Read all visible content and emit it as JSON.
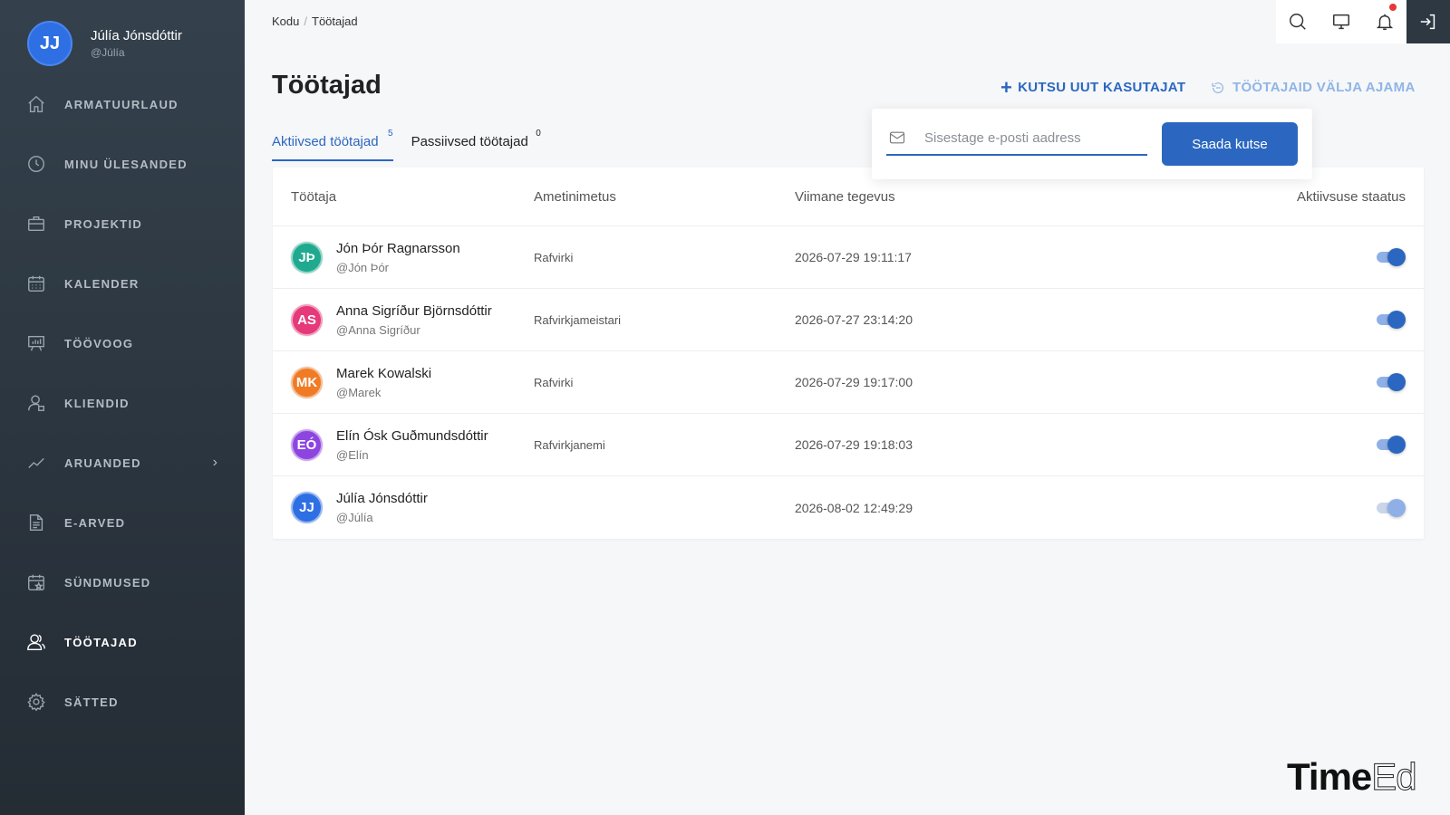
{
  "user": {
    "initials": "JJ",
    "name": "Júlía Jónsdóttir",
    "handle": "@Júlía",
    "avatar_color": "#2f6fe4"
  },
  "sidebar": {
    "items": [
      {
        "label": "ARMATUURLAUD",
        "icon": "home-icon"
      },
      {
        "label": "MINU ÜLESANDED",
        "icon": "clock-icon"
      },
      {
        "label": "PROJEKTID",
        "icon": "briefcase-icon"
      },
      {
        "label": "KALENDER",
        "icon": "calendar-icon"
      },
      {
        "label": "TÖÖVOOG",
        "icon": "presentation-board-icon"
      },
      {
        "label": "KLIENDID",
        "icon": "user-icon"
      },
      {
        "label": "ARUANDED",
        "icon": "trend-line-icon"
      },
      {
        "label": "E-ARVED",
        "icon": "document-icon"
      },
      {
        "label": "SÜNDMUSED",
        "icon": "calendar-star-icon"
      },
      {
        "label": "TÖÖTAJAD",
        "icon": "users-icon"
      },
      {
        "label": "SÄTTED",
        "icon": "gear-icon"
      }
    ]
  },
  "breadcrumb": {
    "home": "Kodu",
    "current": "Töötajad"
  },
  "header": {
    "title": "Töötajad",
    "invite_label": "KUTSU UUT KASUTAJAT",
    "logout_all_label": "TÖÖTAJAID VÄLJA AJAMA"
  },
  "tabs": [
    {
      "label": "Aktiivsed töötajad",
      "count": "5"
    },
    {
      "label": "Passiivsed töötajad",
      "count": "0"
    }
  ],
  "invite": {
    "placeholder": "Sisestage e-posti aadress",
    "button": "Saada kutse"
  },
  "table": {
    "columns": [
      "Töötaja",
      "Ametinimetus",
      "Viimane tegevus",
      "Aktiivsuse staatus"
    ],
    "rows": [
      {
        "initials": "JÞ",
        "name": "Jón Þór Ragnarsson",
        "handle": "@Jón Þór",
        "title": "Rafvirki",
        "last": "2026-07-29 19:11:17",
        "color": "#1faa8f",
        "active": true
      },
      {
        "initials": "AS",
        "name": "Anna Sigríður Björnsdóttir",
        "handle": "@Anna Sigríður",
        "title": "Rafvirkjameistari",
        "last": "2026-07-27 23:14:20",
        "color": "#e6397a",
        "active": true
      },
      {
        "initials": "MK",
        "name": "Marek Kowalski",
        "handle": "@Marek",
        "title": "Rafvirki",
        "last": "2026-07-29 19:17:00",
        "color": "#f07b25",
        "active": true
      },
      {
        "initials": "EÓ",
        "name": "Elín Ósk Guðmundsdóttir",
        "handle": "@Elín",
        "title": "Rafvirkjanemi",
        "last": "2026-07-29 19:18:03",
        "color": "#8e45e0",
        "active": true
      },
      {
        "initials": "JJ",
        "name": "Júlía Jónsdóttir",
        "handle": "@Júlía",
        "title": "",
        "last": "2026-08-02 12:49:29",
        "color": "#2f6fe4",
        "active": false
      }
    ]
  },
  "brand": {
    "part1": "Time",
    "part2": "Ed"
  }
}
